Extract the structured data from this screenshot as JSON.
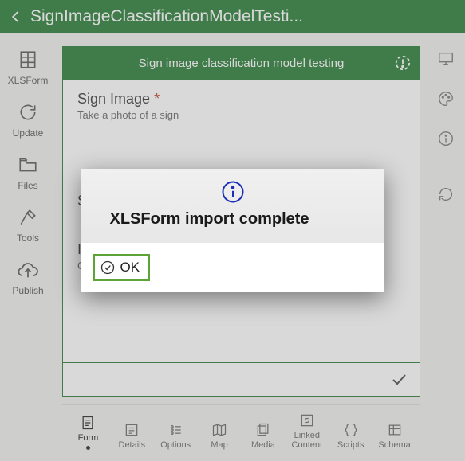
{
  "header": {
    "title": "SignImageClassificationModelTesti..."
  },
  "leftRail": {
    "xlsform": "XLSForm",
    "update": "Update",
    "files": "Files",
    "tools": "Tools",
    "publish": "Publish"
  },
  "form": {
    "title": "Sign image classification model testing",
    "q1_title": "Sign Image",
    "q1_required": " *",
    "q1_hint": "Take a photo of a sign",
    "q2_title_stub": "S",
    "q3_title_stub": "I",
    "q3_hint": "Choose yes for the type is what you expect, otherwise choose no"
  },
  "tabs": {
    "form": "Form",
    "details": "Details",
    "options": "Options",
    "map": "Map",
    "media": "Media",
    "linked": "Linked Content",
    "scripts": "Scripts",
    "schema": "Schema"
  },
  "dialog": {
    "title": "XLSForm import complete",
    "ok": "OK"
  }
}
